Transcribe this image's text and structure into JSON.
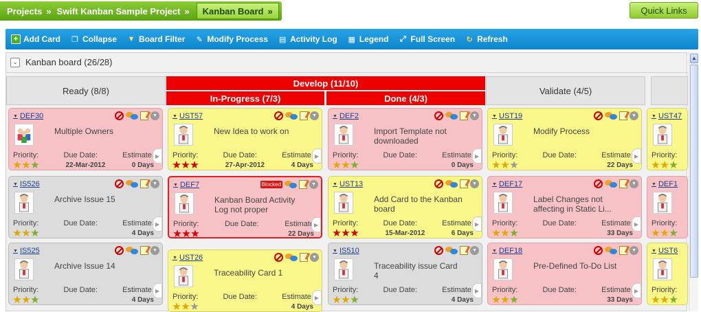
{
  "breadcrumb": {
    "items": [
      "Projects",
      "Swift Kanban Sample Project"
    ],
    "active": "Kanban Board",
    "quick_links": "Quick Links"
  },
  "toolbar": {
    "items": [
      "Add Card",
      "Collapse",
      "Board Filter",
      "Modify Process",
      "Activity Log",
      "Legend",
      "Full Screen",
      "Refresh"
    ]
  },
  "board": {
    "title": "Kanban board (26/28)"
  },
  "columns": {
    "ready": "Ready (8/8)",
    "develop": "Develop (11/10)",
    "inprogress": "In-Progress (7/3)",
    "done": "Done (4/3)",
    "validate": "Validate (4/5)"
  },
  "labels": {
    "priority": "Priority:",
    "due": "Due Date:",
    "estimate": "Estimate:",
    "estimate_b": "Estimate",
    "blocked": "Blocked"
  },
  "colors": {
    "pink": "#f7c2c6",
    "yellow": "#f9f78a",
    "gray": "#dcdcdc",
    "red": "#ee0000",
    "green": "#6fbf1f",
    "blue": "#1a94dc"
  },
  "cards": [
    {
      "id": "DEF30",
      "title": "Multiple Owners",
      "due": "22-Mar-2012",
      "est": "0 Days"
    },
    {
      "id": "IS526",
      "title": "Archive Issue 15",
      "due": "",
      "est": "4 Days"
    },
    {
      "id": "IS525",
      "title": "Archive Issue 14",
      "due": "",
      "est": "4 Days"
    },
    {
      "id": "UST57",
      "title": "New Idea to work on",
      "due": "27-Apr-2012",
      "est": "4 Days"
    },
    {
      "id": "DEF7",
      "title": "Kanban Board Activity Log not proper",
      "due": "",
      "est": "22 Days"
    },
    {
      "id": "UST26",
      "title": "Traceability Card 1",
      "due": "",
      "est": "4 Days"
    },
    {
      "id": "DEF2",
      "title": "Import Template not downloaded",
      "due": "",
      "est": "0 Days"
    },
    {
      "id": "UST13",
      "title": "Add Card to the Kanban board",
      "due": "15-Mar-2012",
      "est": "6 Days"
    },
    {
      "id": "IS510",
      "title": "Traceability issue Card 4",
      "due": "",
      "est": "4 Days"
    },
    {
      "id": "UST19",
      "title": "Modify Process",
      "due": "",
      "est": "22 Days"
    },
    {
      "id": "DEF17",
      "title": "Label Changes not affecting in Static Li...",
      "due": "",
      "est": "33 Days"
    },
    {
      "id": "DEF18",
      "title": "Pre-Defined To-Do List",
      "due": "",
      "est": "33 Days"
    },
    {
      "id": "UST47",
      "title": "",
      "due": "",
      "est": ""
    },
    {
      "id": "DEF1",
      "title": "",
      "due": "",
      "est": ""
    },
    {
      "id": "UST6",
      "title": "",
      "due": "",
      "est": ""
    }
  ]
}
